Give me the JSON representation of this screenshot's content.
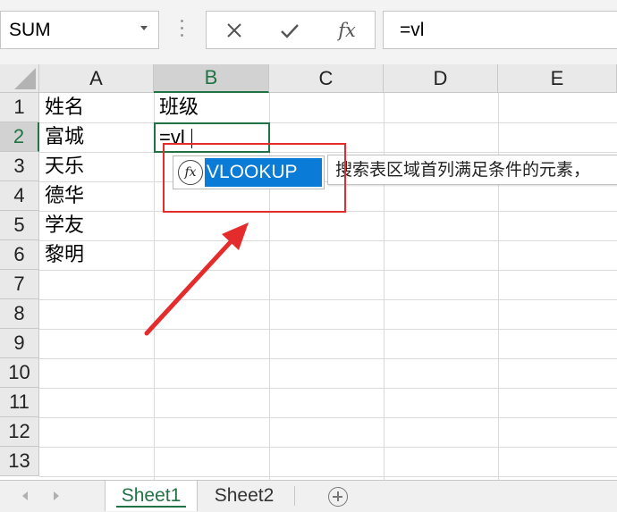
{
  "formula_bar": {
    "name_box": "SUM",
    "cancel_icon": "x-icon",
    "enter_icon": "check-icon",
    "function_button": "fx",
    "formula": "=vl"
  },
  "columns": [
    "A",
    "B",
    "C",
    "D",
    "E"
  ],
  "rows": [
    "1",
    "2",
    "3",
    "4",
    "5",
    "6",
    "7",
    "8",
    "9",
    "10",
    "11",
    "12",
    "13"
  ],
  "cells": {
    "A1": "姓名",
    "B1": "班级",
    "A2": "富城",
    "A3": "天乐",
    "A4": "德华",
    "A5": "学友",
    "A6": "黎明"
  },
  "active_cell": {
    "ref": "B2",
    "value": "=vl"
  },
  "autocomplete": {
    "badge": "fx",
    "items": [
      "VLOOKUP"
    ],
    "tooltip": "搜索表区域首列满足条件的元素，"
  },
  "sheets": {
    "tabs": [
      "Sheet1",
      "Sheet2"
    ],
    "active": "Sheet1"
  },
  "colors": {
    "accent_green": "#217346",
    "selection_blue": "#0a7bd6",
    "annotation_red": "#e52c2c"
  }
}
